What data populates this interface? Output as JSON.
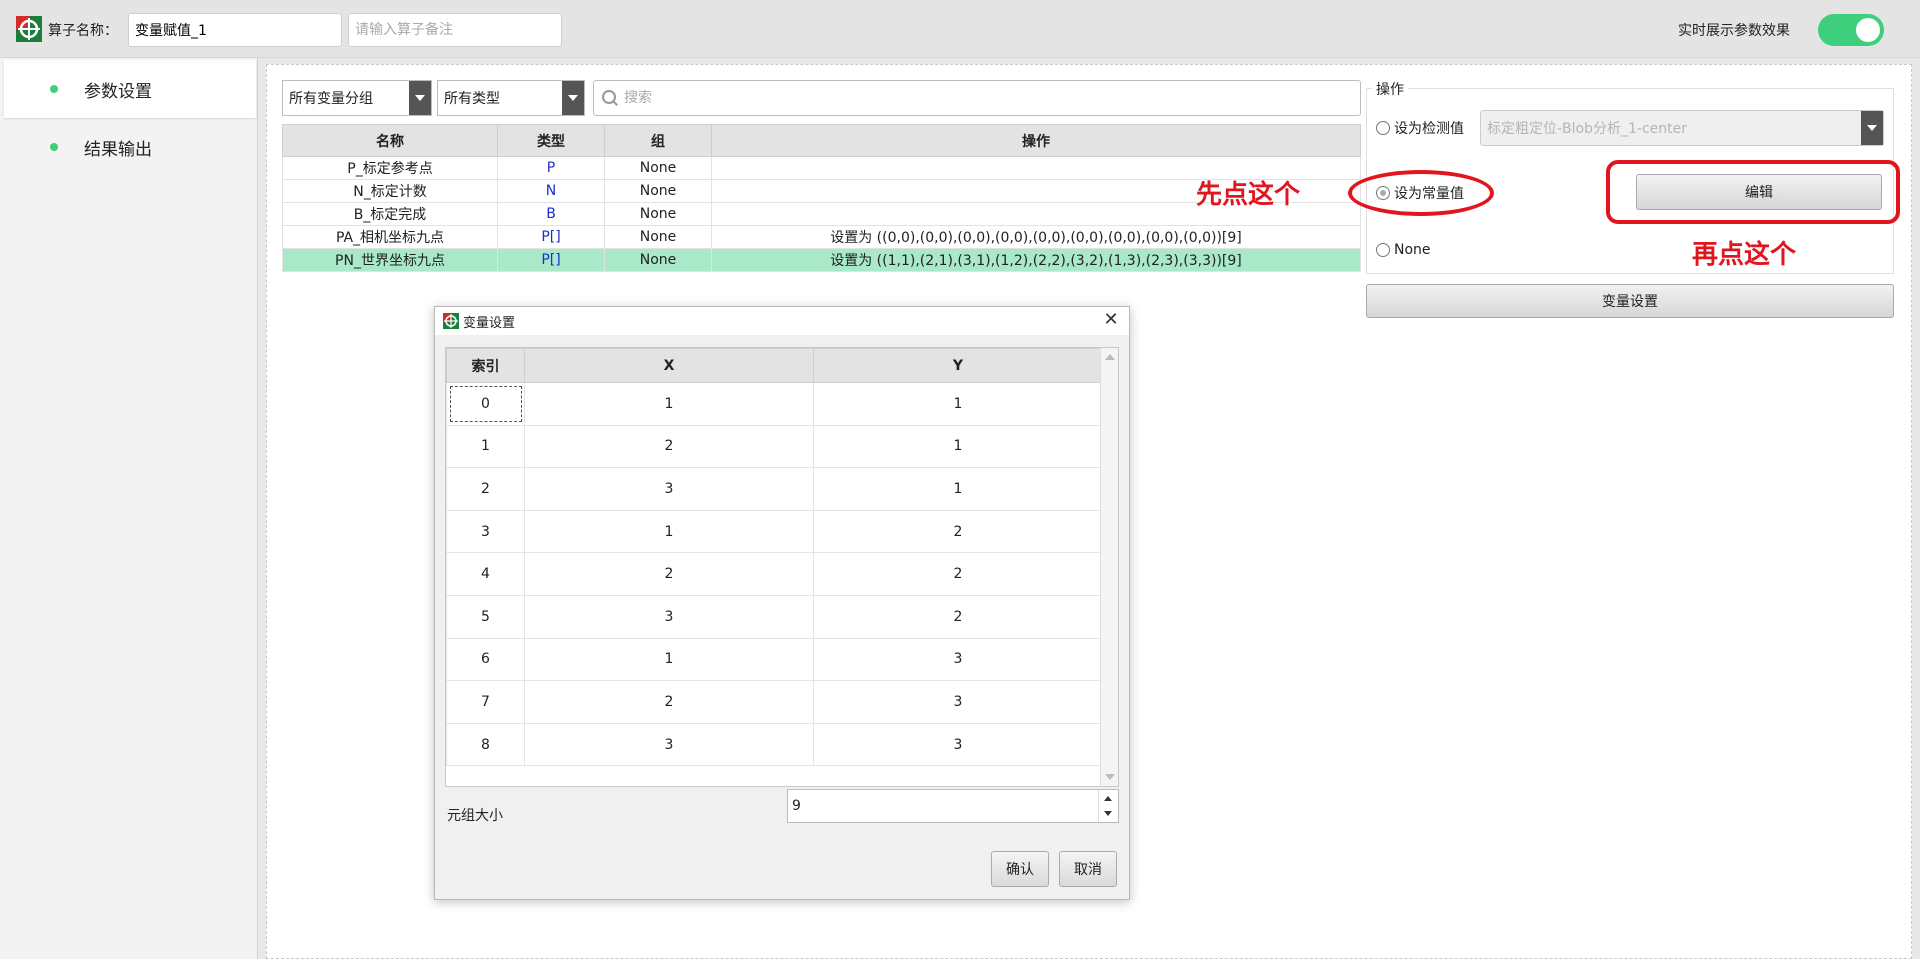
{
  "topbar": {
    "operator_name_label": "算子名称：",
    "operator_name_value": "变量赋值_1",
    "remark_placeholder": "请输入算子备注",
    "realtime_label": "实时展示参数效果",
    "realtime_enabled": true,
    "toggle_color": "#3ecf7c"
  },
  "sidebar": {
    "items": [
      {
        "label": "参数设置",
        "active": true
      },
      {
        "label": "结果输出",
        "active": false
      }
    ]
  },
  "filters": {
    "group": "所有变量分组",
    "type": "所有类型",
    "search_placeholder": "搜索"
  },
  "variables": {
    "columns": [
      "名称",
      "类型",
      "组",
      "操作"
    ],
    "rows": [
      {
        "name": "P_标定参考点",
        "type": "P",
        "group": "None",
        "operation": ""
      },
      {
        "name": "N_标定计数",
        "type": "N",
        "group": "None",
        "operation": ""
      },
      {
        "name": "B_标定完成",
        "type": "B",
        "group": "None",
        "operation": ""
      },
      {
        "name": "PA_相机坐标九点",
        "type": "P[]",
        "group": "None",
        "operation": "设置为 ((0,0),(0,0),(0,0),(0,0),(0,0),(0,0),(0,0),(0,0),(0,0))[9]"
      },
      {
        "name": "PN_世界坐标九点",
        "type": "P[]",
        "group": "None",
        "operation": "设置为 ((1,1),(2,1),(3,1),(1,2),(2,2),(3,2),(1,3),(2,3),(3,3))[9]"
      }
    ],
    "selected_color": "#a9e8c9",
    "type_color": "#1d2bd1"
  },
  "operations": {
    "title": "操作",
    "detect_label": "设为检测值",
    "detect_value": "标定粗定位-Blob分析_1-center",
    "constant_label": "设为常量值",
    "none_label": "None",
    "edit_label": "编辑",
    "var_setting_label": "变量设置"
  },
  "annotations": {
    "step1": "先点这个",
    "step2": "再点这个",
    "color": "#e2141e"
  },
  "dialog": {
    "title": "变量设置",
    "columns": [
      "索引",
      "X",
      "Y"
    ],
    "rows": [
      {
        "index": "0",
        "x": "1",
        "y": "1"
      },
      {
        "index": "1",
        "x": "2",
        "y": "1"
      },
      {
        "index": "2",
        "x": "3",
        "y": "1"
      },
      {
        "index": "3",
        "x": "1",
        "y": "2"
      },
      {
        "index": "4",
        "x": "2",
        "y": "2"
      },
      {
        "index": "5",
        "x": "3",
        "y": "2"
      },
      {
        "index": "6",
        "x": "1",
        "y": "3"
      },
      {
        "index": "7",
        "x": "2",
        "y": "3"
      },
      {
        "index": "8",
        "x": "3",
        "y": "3"
      }
    ],
    "size_label": "元组大小",
    "size_value": "9",
    "confirm_label": "确认",
    "cancel_label": "取消",
    "close_icon": "close-icon"
  }
}
